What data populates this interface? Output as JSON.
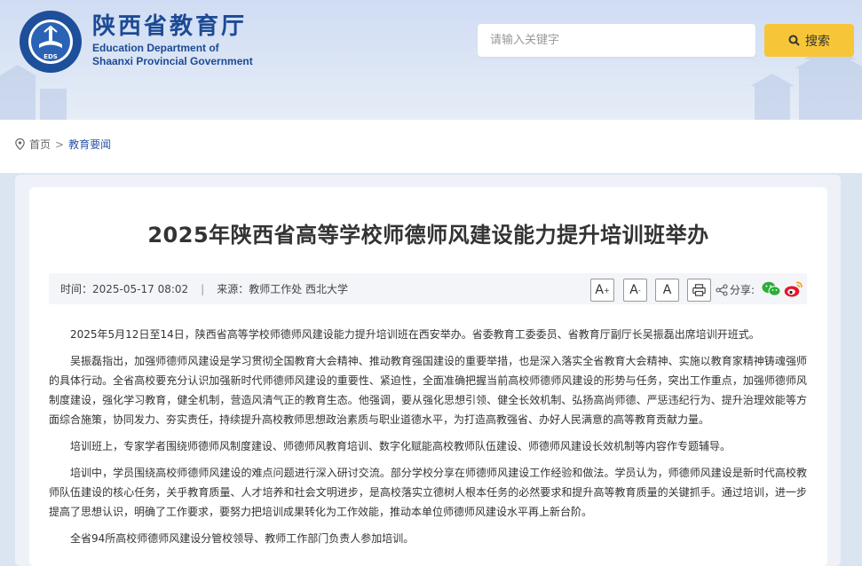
{
  "header": {
    "title_cn": "陕西省教育厅",
    "title_en_line1": "Education Department of",
    "title_en_line2": "Shaanxi Provincial Government",
    "emblem_text": "EDS",
    "search_placeholder": "请输入关键字",
    "search_button_label": "搜索",
    "accent_color": "#f7c638",
    "brand_color": "#1c4a95"
  },
  "breadcrumb": {
    "home": "首页",
    "separator": ">",
    "current": "教育要闻"
  },
  "article": {
    "title": "2025年陕西省高等学校师德师风建设能力提升培训班举办",
    "time_label": "时间：",
    "time_value": "2025-05-17 08:02",
    "divider": "|",
    "source_label": "来源：",
    "source_value": "教师工作处 西北大学",
    "font_large": "A",
    "font_medium": "A",
    "font_small": "A",
    "share_label": "分享:",
    "paragraphs": [
      "2025年5月12日至14日，陕西省高等学校师德师风建设能力提升培训班在西安举办。省委教育工委委员、省教育厅副厅长吴振磊出席培训开班式。",
      "吴振磊指出，加强师德师风建设是学习贯彻全国教育大会精神、推动教育强国建设的重要举措，也是深入落实全省教育大会精神、实施以教育家精神铸魂强师的具体行动。全省高校要充分认识加强新时代师德师风建设的重要性、紧迫性，全面准确把握当前高校师德师风建设的形势与任务，突出工作重点，加强师德师风制度建设，强化学习教育，健全机制，营造风清气正的教育生态。他强调，要从强化思想引领、健全长效机制、弘扬高尚师德、严惩违纪行为、提升治理效能等方面综合施策，协同发力、夯实责任，持续提升高校教师思想政治素质与职业道德水平，为打造高教强省、办好人民满意的高等教育贡献力量。",
      "培训班上，专家学者围绕师德师风制度建设、师德师风教育培训、数字化赋能高校教师队伍建设、师德师风建设长效机制等内容作专题辅导。",
      "培训中，学员围绕高校师德师风建设的难点问题进行深入研讨交流。部分学校分享在师德师风建设工作经验和做法。学员认为，师德师风建设是新时代高校教师队伍建设的核心任务，关乎教育质量、人才培养和社会文明进步，是高校落实立德树人根本任务的必然要求和提升高等教育质量的关键抓手。通过培训，进一步提高了思想认识，明确了工作要求，要努力把培训成果转化为工作效能，推动本单位师德师风建设水平再上新台阶。",
      "全省94所高校师德师风建设分管校领导、教师工作部门负责人参加培训。"
    ]
  }
}
